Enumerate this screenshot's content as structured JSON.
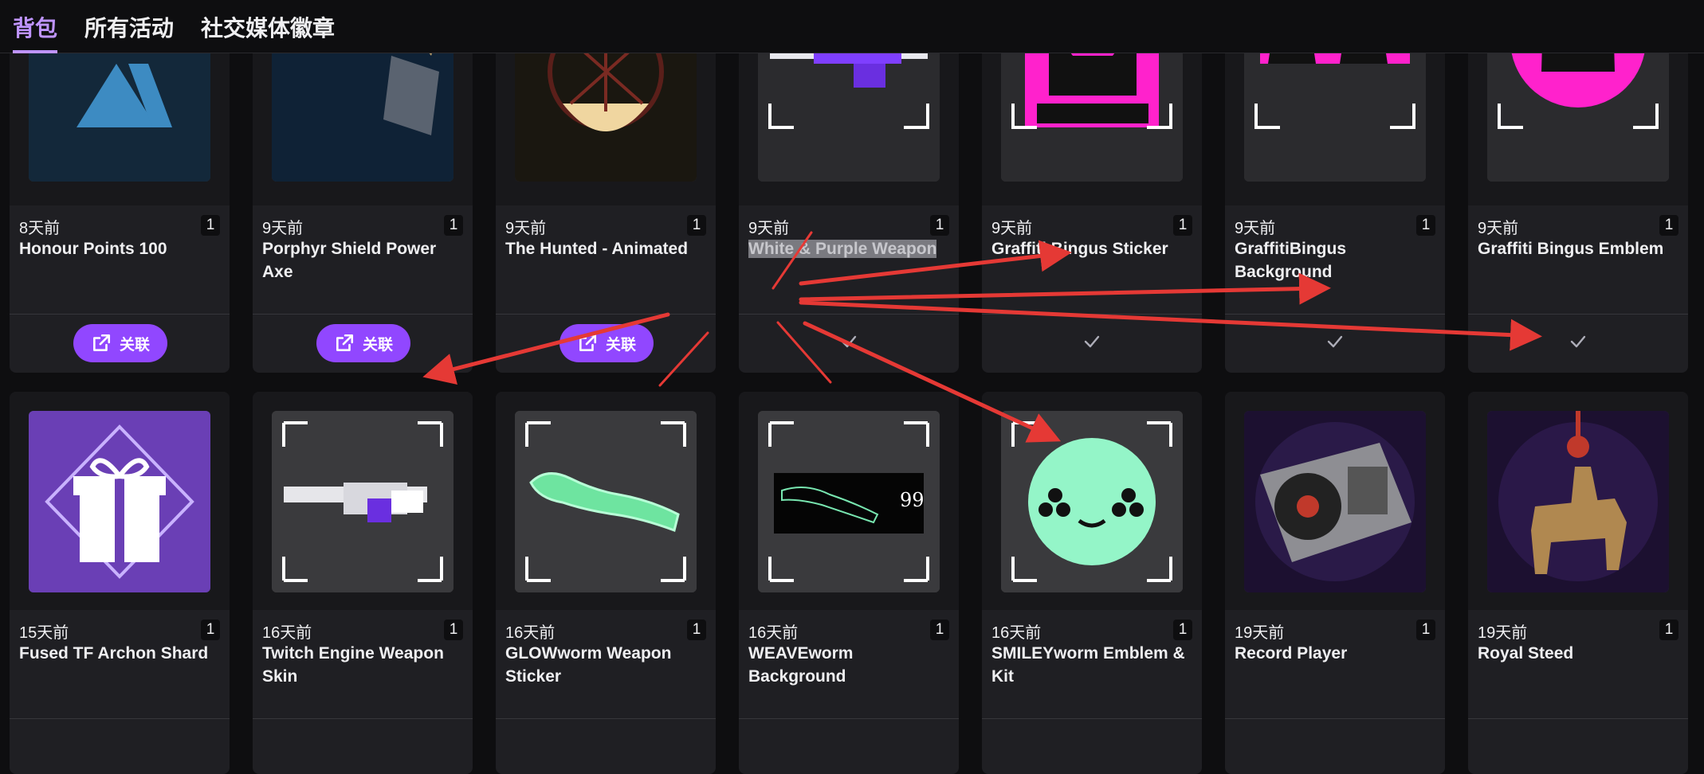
{
  "tabs": [
    "背包",
    "所有活动",
    "社交媒体徽章"
  ],
  "link_label": "关联",
  "row1": [
    {
      "date": "8天前",
      "qty": "1",
      "title": "Honour Points 100",
      "thumb": "honour-logo",
      "action": "link"
    },
    {
      "date": "9天前",
      "qty": "1",
      "title": "Porphyr Shield Power Axe",
      "thumb": "axe",
      "action": "link"
    },
    {
      "date": "9天前",
      "qty": "1",
      "title": "The Hunted - Animated",
      "thumb": "hunted",
      "action": "link"
    },
    {
      "date": "9天前",
      "qty": "1",
      "title": "White & Purple Weapon",
      "thumb": "purple-rifle",
      "action": "check"
    },
    {
      "date": "9天前",
      "qty": "1",
      "title": "Graffiti Bingus Sticker",
      "thumb": "bingus-sticker",
      "action": "check"
    },
    {
      "date": "9天前",
      "qty": "1",
      "title": "GraffitiBingus Background",
      "thumb": "bingus-background",
      "action": "check"
    },
    {
      "date": "9天前",
      "qty": "1",
      "title": "Graffiti Bingus Emblem",
      "thumb": "bingus-emblem",
      "action": "check"
    }
  ],
  "row2": [
    {
      "date": "15天前",
      "qty": "1",
      "title": "Fused TF Archon Shard",
      "thumb": "gift"
    },
    {
      "date": "16天前",
      "qty": "1",
      "title": "Twitch Engine Weapon Skin",
      "thumb": "white-gun"
    },
    {
      "date": "16天前",
      "qty": "1",
      "title": "GLOWworm Weapon Sticker",
      "thumb": "glowworm"
    },
    {
      "date": "16天前",
      "qty": "1",
      "title": "WEAVEworm Background",
      "thumb": "weaveworm"
    },
    {
      "date": "16天前",
      "qty": "1",
      "title": "SMILEYworm Emblem & Kit",
      "thumb": "smiley"
    },
    {
      "date": "19天前",
      "qty": "1",
      "title": "Record Player",
      "thumb": "record-player"
    },
    {
      "date": "19天前",
      "qty": "1",
      "title": "Royal Steed",
      "thumb": "royal-steed"
    }
  ],
  "weave_number": "99",
  "colors": {
    "accent": "#9147ff",
    "tab_active": "#bf94ff",
    "card": "#1f1f23",
    "annotation": "#e53935"
  }
}
